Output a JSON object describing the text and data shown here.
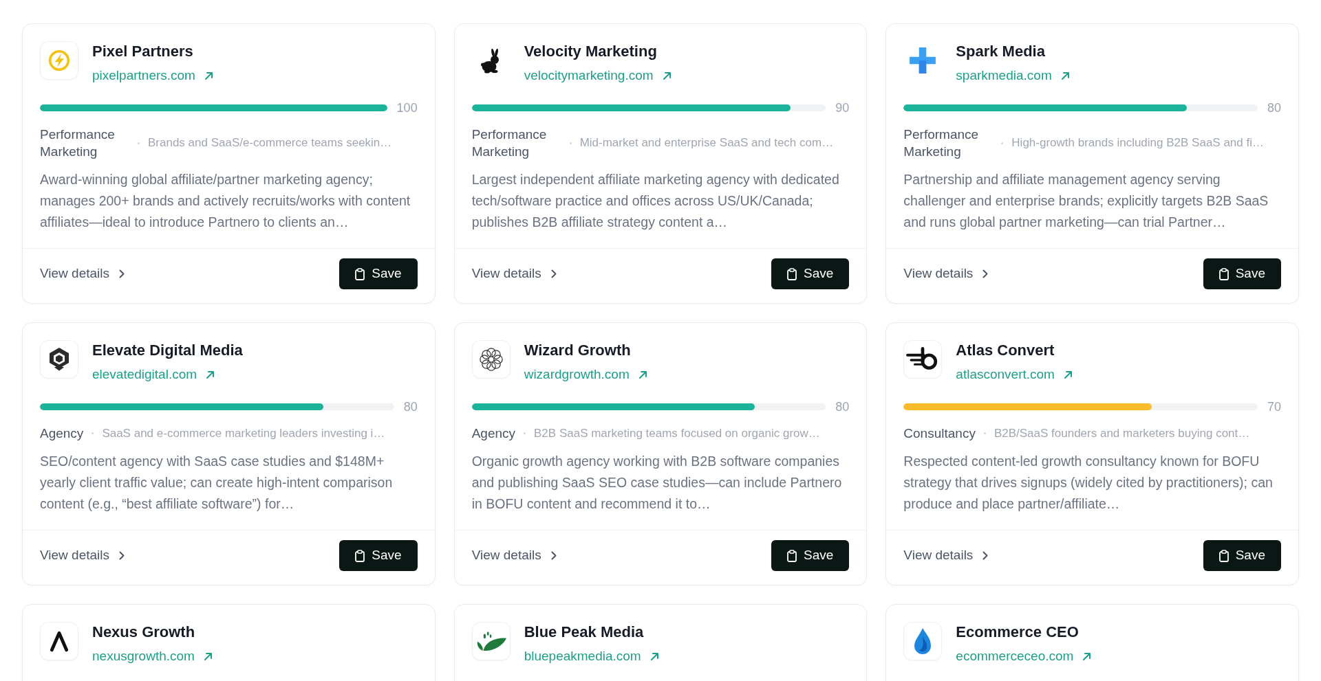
{
  "cards": [
    {
      "name": "Pixel Partners",
      "website": "pixelpartners.com",
      "score": {
        "level": 1,
        "reading": "100",
        "color": "#1bb49a"
      },
      "category": "Performance Marketing",
      "audience": "Brands and SaaS/e-commerce teams seekin…",
      "description": "Award-winning global affiliate/partner marketing agency; manages 200+ brands and actively recruits/works with content affiliates—ideal to introduce Partnero to clients an…",
      "details_link": "View details",
      "save_button": "Save"
    },
    {
      "name": "Velocity Marketing",
      "website": "velocitymarketing.com",
      "score": {
        "level": 0.9,
        "reading": "90",
        "color": "#1bb49a"
      },
      "category": "Performance Marketing",
      "audience": "Mid-market and enterprise SaaS and tech com…",
      "description": "Largest independent affiliate marketing agency with dedicated tech/software practice and offices across US/UK/Canada; publishes B2B affiliate strategy content a…",
      "details_link": "View details",
      "save_button": "Save"
    },
    {
      "name": "Spark Media",
      "website": "sparkmedia.com",
      "score": {
        "level": 0.8,
        "reading": "80",
        "color": "#1bb49a"
      },
      "category": "Performance Marketing",
      "audience": "High-growth brands including B2B SaaS and fi…",
      "description": "Partnership and affiliate management agency serving challenger and enterprise brands; explicitly targets B2B SaaS and runs global partner marketing—can trial Partner…",
      "details_link": "View details",
      "save_button": "Save"
    },
    {
      "name": "Elevate Digital Media",
      "website": "elevatedigital.com",
      "score": {
        "level": 0.8,
        "reading": "80",
        "color": "#1bb49a"
      },
      "category": "Agency",
      "audience": "SaaS and e-commerce marketing leaders investing i…",
      "description": "SEO/content agency with SaaS case studies and $148M+ yearly client traffic value; can create high-intent comparison content (e.g., “best affiliate software”) for…",
      "details_link": "View details",
      "save_button": "Save"
    },
    {
      "name": "Wizard Growth",
      "website": "wizardgrowth.com",
      "score": {
        "level": 0.8,
        "reading": "80",
        "color": "#1bb49a"
      },
      "category": "Agency",
      "audience": "B2B SaaS marketing teams focused on organic grow…",
      "description": "Organic growth agency working with B2B software companies and publishing SaaS SEO case studies—can include Partnero in BOFU content and recommend it to…",
      "details_link": "View details",
      "save_button": "Save"
    },
    {
      "name": "Atlas Convert",
      "website": "atlasconvert.com",
      "score": {
        "level": 0.7,
        "reading": "70",
        "color": "#fbbc2c"
      },
      "category": "Consultancy",
      "audience": "B2B/SaaS founders and marketers buying cont…",
      "description": "Respected content-led growth consultancy known for BOFU strategy that drives signups (widely cited by practitioners); can produce and place partner/affiliate…",
      "details_link": "View details",
      "save_button": "Save"
    },
    {
      "name": "Nexus Growth",
      "website": "nexusgrowth.com"
    },
    {
      "name": "Blue Peak Media",
      "website": "bluepeakmedia.com"
    },
    {
      "name": "Ecommerce CEO",
      "website": "ecommerceceo.com"
    }
  ]
}
